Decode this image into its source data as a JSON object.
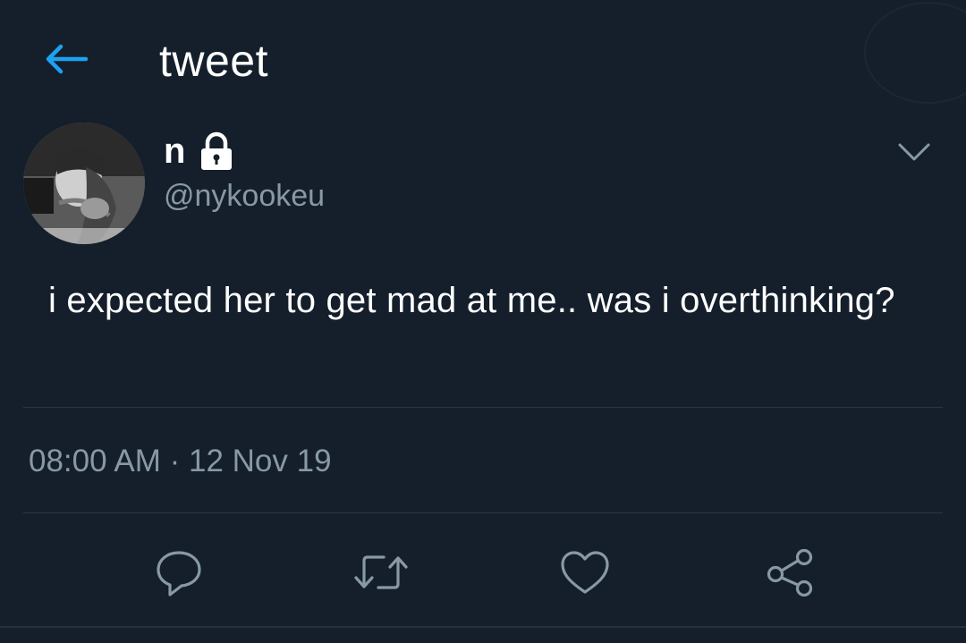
{
  "header": {
    "title": "tweet",
    "back_icon": "arrow-left-icon"
  },
  "author": {
    "display_name": "n",
    "handle": "@nykookeu",
    "protected": true,
    "lock_icon": "lock-icon",
    "menu_icon": "chevron-down-icon"
  },
  "tweet": {
    "text": "i expected her to get mad at me.. was i overthinking?",
    "timestamp": "08:00 AM · 12 Nov 19"
  },
  "actions": [
    {
      "name": "reply",
      "icon": "reply-icon"
    },
    {
      "name": "retweet",
      "icon": "retweet-icon"
    },
    {
      "name": "like",
      "icon": "heart-icon"
    },
    {
      "name": "share",
      "icon": "share-icon"
    }
  ],
  "colors": {
    "background": "#151f2b",
    "accent": "#1da1f2",
    "secondary_text": "#8899a6",
    "divider": "#2a3744"
  }
}
